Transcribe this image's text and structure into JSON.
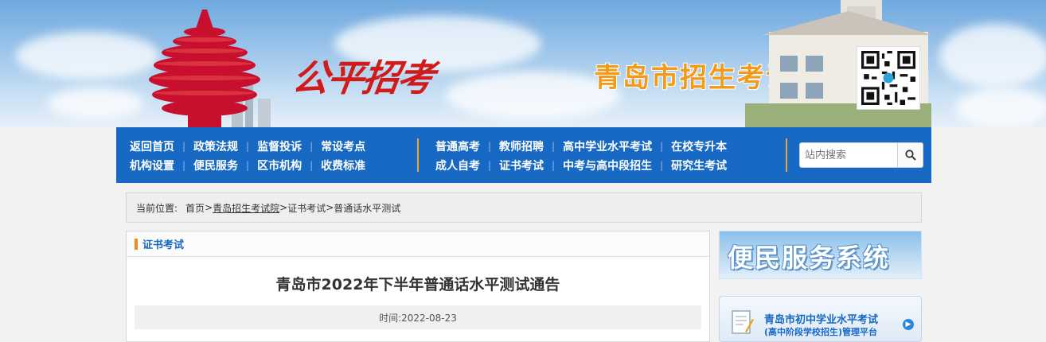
{
  "header": {
    "calligraphy": "公平招考",
    "site_name": "青岛市招生考试院"
  },
  "nav": {
    "group1_row1": [
      "返回首页",
      "政策法规",
      "监督投诉",
      "常设考点"
    ],
    "group1_row2": [
      "机构设置",
      "便民服务",
      "区市机构",
      "收费标准"
    ],
    "group2_row1": [
      "普通高考",
      "教师招聘",
      "高中学业水平考试",
      "在校专升本"
    ],
    "group2_row2": [
      "成人自考",
      "证书考试",
      "中考与高中段招生",
      "研究生考试"
    ],
    "search_placeholder": "站内搜索"
  },
  "breadcrumb": {
    "label": "当前位置:",
    "home": "首页",
    "sep": ">",
    "site": "青岛招生考试院",
    "section": "证书考试",
    "page": "普通话水平测试"
  },
  "article": {
    "category": "证书考试",
    "title": "青岛市2022年下半年普通话水平测试通告",
    "time": "时间:2022-08-23"
  },
  "sidebar": {
    "banner_text": "便民服务系统",
    "platform_line1": "青岛市初中学业水平考试",
    "platform_line2": "(高中阶段学校招生)管理平台"
  },
  "colors": {
    "nav_bg": "#1769c4",
    "accent_orange": "#f3a325",
    "title_red": "#d11a1a"
  }
}
